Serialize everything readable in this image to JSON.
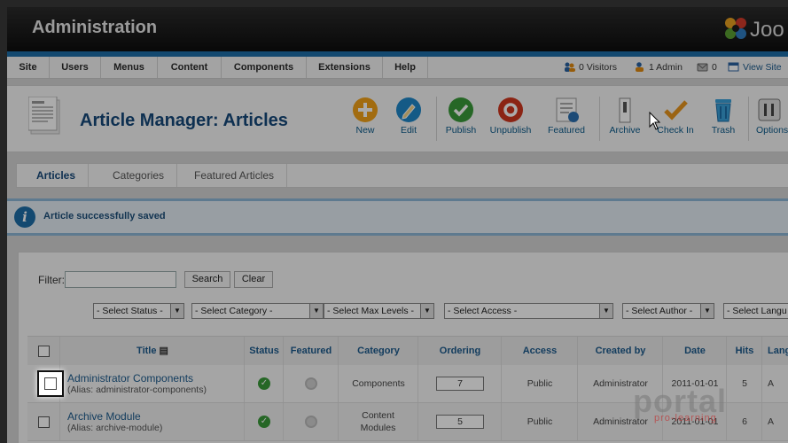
{
  "header": {
    "title": "Administration",
    "logo_text": "Joo"
  },
  "menu": {
    "items": [
      "Site",
      "Users",
      "Menus",
      "Content",
      "Components",
      "Extensions",
      "Help"
    ],
    "status": {
      "visitors": "0 Visitors",
      "admins": "1 Admin",
      "messages": "0",
      "view_site": "View Site"
    }
  },
  "toolbar": {
    "title": "Article Manager: Articles",
    "buttons": [
      {
        "label": "New",
        "icon": "plus-icon",
        "color": "#f2a218"
      },
      {
        "label": "Edit",
        "icon": "pencil-icon",
        "color": "#1f87c8"
      },
      {
        "label": "Publish",
        "icon": "check-icon",
        "color": "#3a9a3a"
      },
      {
        "label": "Unpublish",
        "icon": "unpublish-icon",
        "color": "#d0361e"
      },
      {
        "label": "Featured",
        "icon": "featured-icon"
      },
      {
        "label": "Archive",
        "icon": "archive-icon"
      },
      {
        "label": "Check In",
        "icon": "checkin-icon"
      },
      {
        "label": "Trash",
        "icon": "trash-icon"
      },
      {
        "label": "Options",
        "icon": "options-icon"
      }
    ]
  },
  "tabs": [
    "Articles",
    "Categories",
    "Featured Articles"
  ],
  "message": "Article successfully saved",
  "filters": {
    "filter_label": "Filter:",
    "search_label": "Search",
    "clear_label": "Clear",
    "selects": [
      "- Select Status -",
      "- Select Category -",
      "- Select Max Levels -",
      "- Select Access -",
      "- Select Author -",
      "- Select Langu"
    ]
  },
  "table": {
    "headers": [
      "Title",
      "Status",
      "Featured",
      "Category",
      "Ordering",
      "Access",
      "Created by",
      "Date",
      "Hits",
      "Langu"
    ],
    "rows": [
      {
        "title": "Administrator Components",
        "alias": "(Alias: administrator-components)",
        "category": "Components",
        "ordering": "7",
        "access": "Public",
        "created_by": "Administrator",
        "date": "2011-01-01",
        "hits": "5",
        "language": "A"
      },
      {
        "title": "Archive Module",
        "alias": "(Alias: archive-module)",
        "category": "Content Modules",
        "ordering": "5",
        "access": "Public",
        "created_by": "Administrator",
        "date": "2011-01-01",
        "hits": "6",
        "language": "A"
      }
    ]
  },
  "watermark": {
    "main": "portal",
    "sub": "pro-learning"
  }
}
